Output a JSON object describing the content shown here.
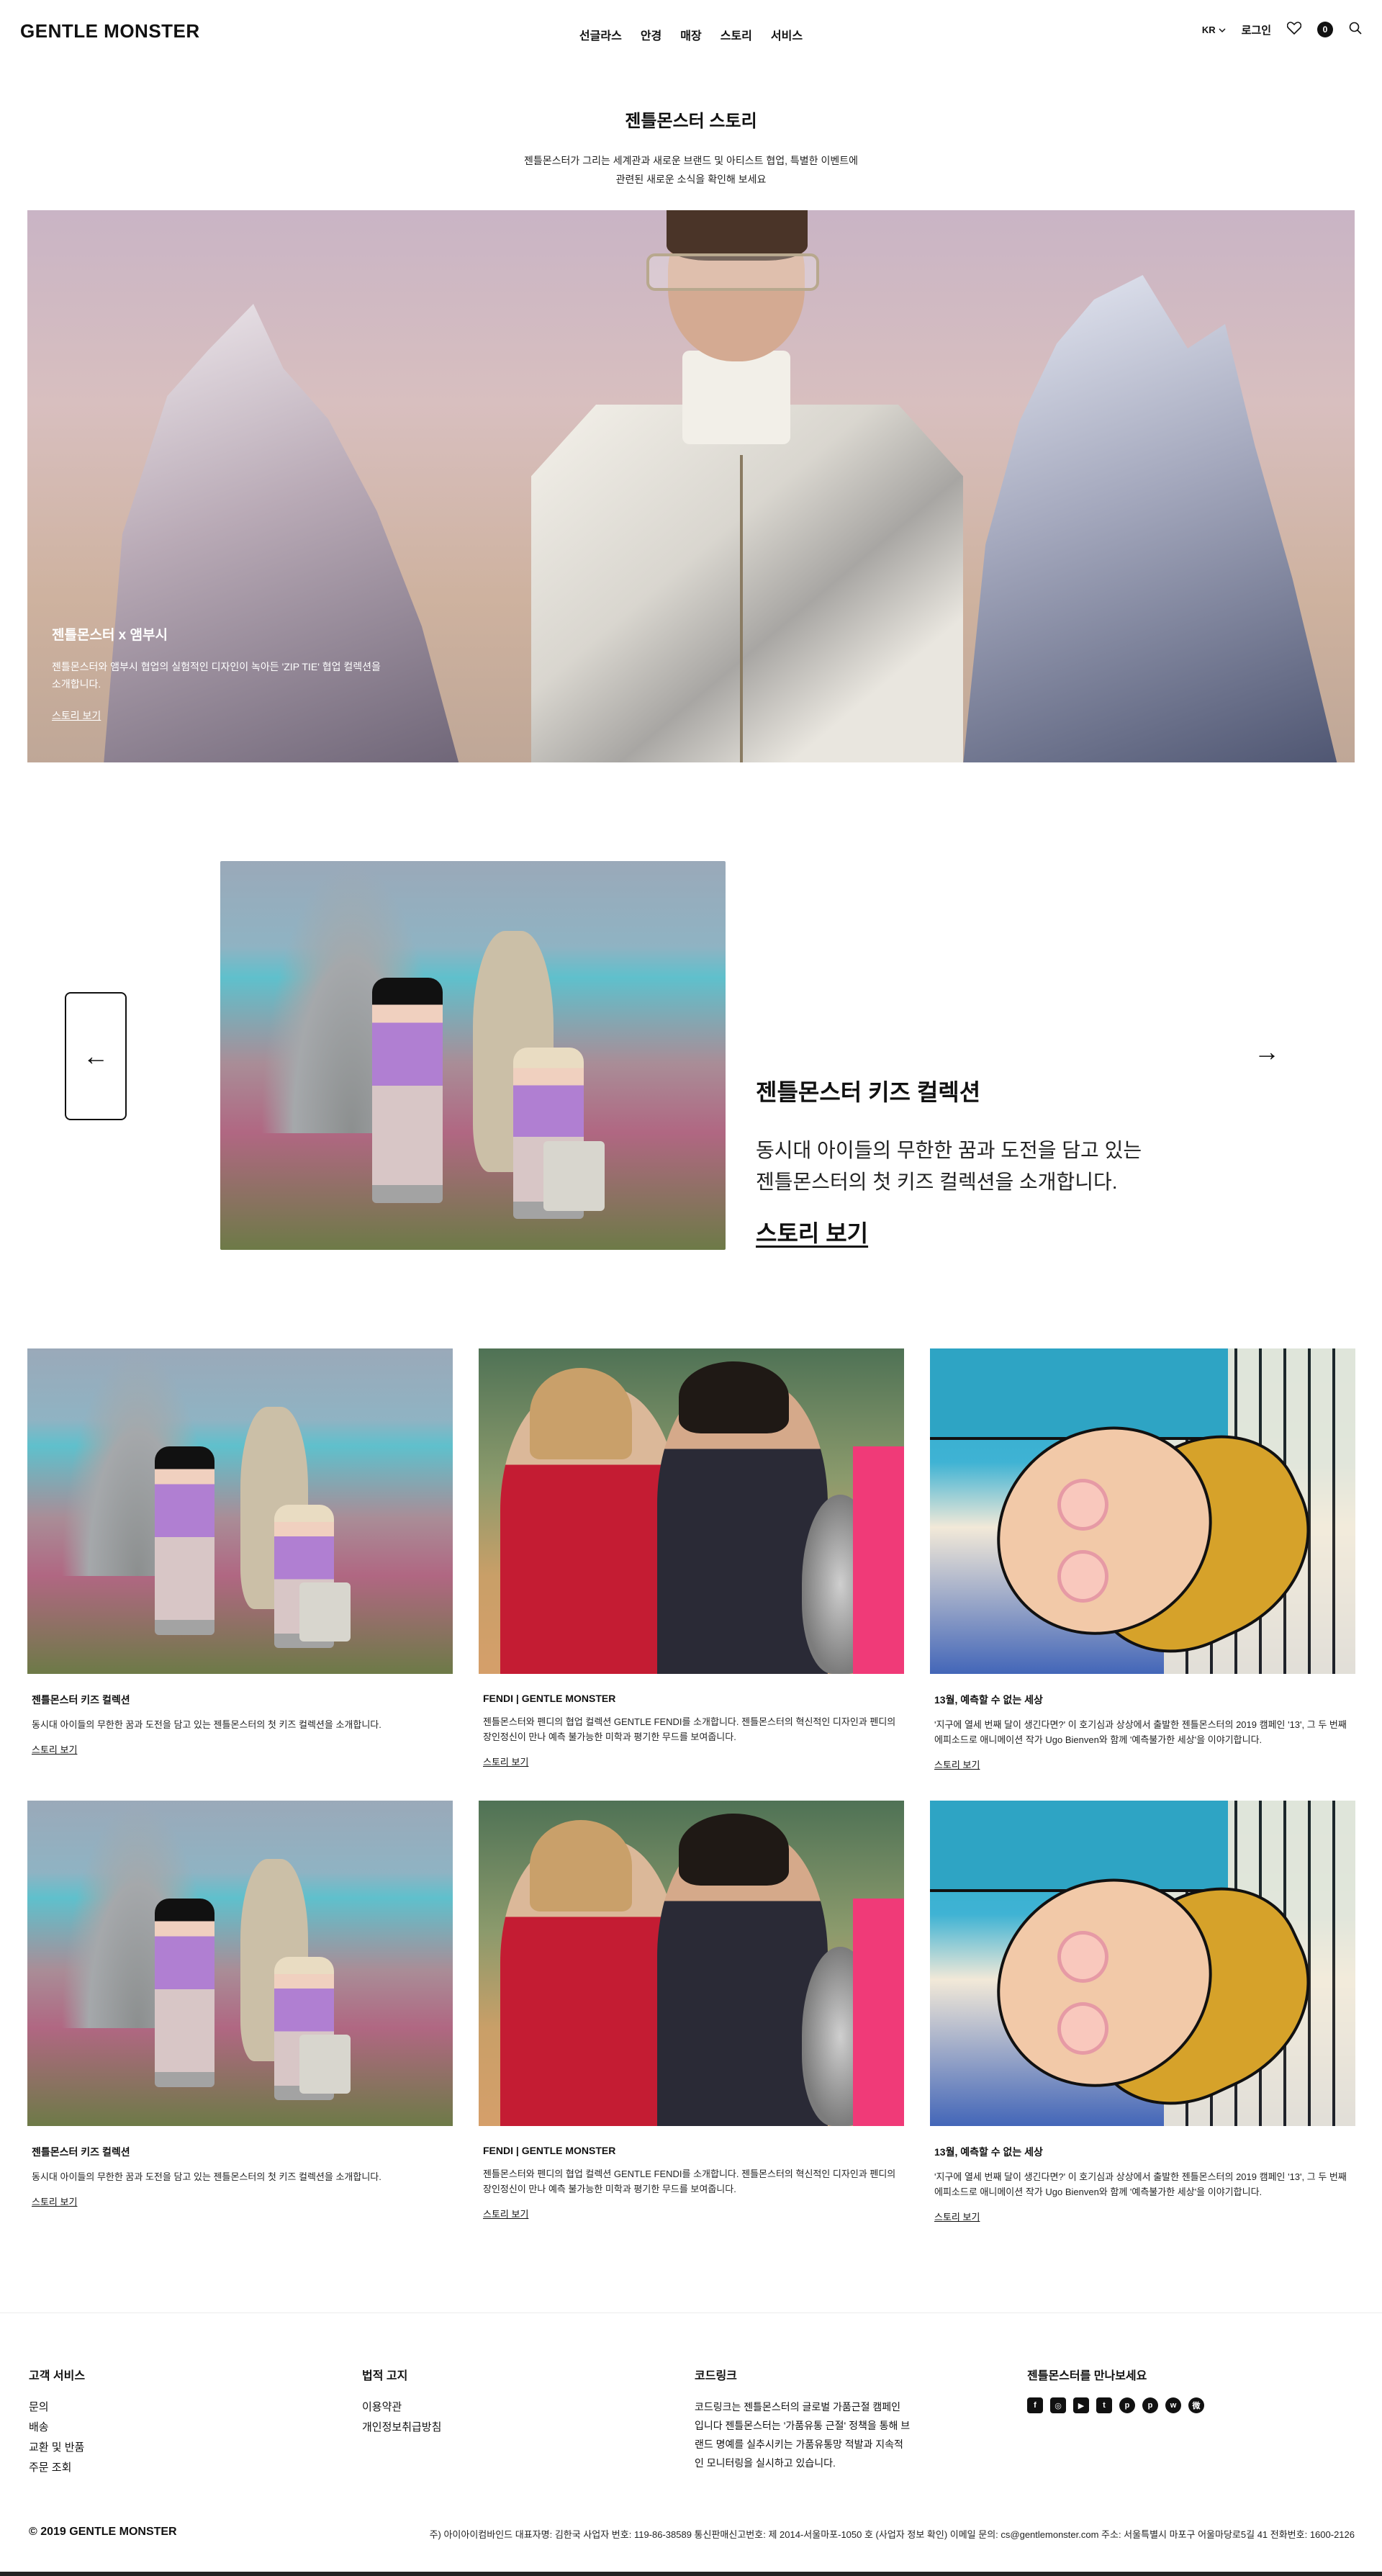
{
  "header": {
    "logo": "GENTLE MONSTER",
    "nav": [
      "선글라스",
      "안경",
      "매장",
      "스토리",
      "서비스"
    ],
    "lang": "KR",
    "login": "로그인",
    "cart_count": "0"
  },
  "intro": {
    "title": "젠틀몬스터 스토리",
    "desc_line1": "젠틀몬스터가 그리는 세계관과 새로운 브랜드 및 아티스트 협업, 특별한 이벤트에",
    "desc_line2": "관련된 새로운 소식을 확인해 보세요"
  },
  "hero": {
    "title": "젠틀몬스터 x 앰부시",
    "desc": "젠틀몬스터와 앰부시 협업의 실험적인 디자인이 녹아든 'ZIP TIE' 협업 컬렉션을 소개합니다.",
    "link": "스토리 보기"
  },
  "feature": {
    "prev": "←",
    "next": "→",
    "title": "젠틀몬스터 키즈 컬렉션",
    "desc_line1": "동시대 아이들의 무한한 꿈과 도전을 담고 있는",
    "desc_line2": "젠틀몬스터의 첫 키즈 컬렉션을 소개합니다.",
    "link": "스토리 보기"
  },
  "cards": [
    {
      "title": "젠틀몬스터 키즈 컬렉션",
      "desc": "동시대 아이들의 무한한 꿈과 도전을 담고 있는 젠틀몬스터의 첫 키즈 컬렉션을 소개합니다.",
      "link": "스토리 보기"
    },
    {
      "title": "FENDI | GENTLE MONSTER",
      "desc": "젠틀몬스터와 펜디의 협업 컬렉션 GENTLE FENDI를 소개합니다. 젠틀몬스터의 혁신적인 디자인과 펜디의 장인정신이 만나 예측 불가능한 미학과 평기한 무드를 보여줍니다.",
      "link": "스토리 보기"
    },
    {
      "title": "13월, 예측할 수 없는 세상",
      "desc": "'지구에 열세 번째 달이 생긴다면?' 이 호기심과 상상에서 출발한 젠틀몬스터의 2019 캠페인 '13', 그 두 번째 에피소드로 애니메이션 작가 Ugo Bienven와 함께 '예측불가한 세상'을 이야기합니다.",
      "link": "스토리 보기"
    },
    {
      "title": "젠틀몬스터 키즈 컬렉션",
      "desc": "동시대 아이들의 무한한 꿈과 도전을 담고 있는 젠틀몬스터의 첫 키즈 컬렉션을 소개합니다.",
      "link": "스토리 보기"
    },
    {
      "title": "FENDI | GENTLE MONSTER",
      "desc": "젠틀몬스터와 펜디의 협업 컬렉션 GENTLE FENDI를 소개합니다. 젠틀몬스터의 혁신적인 디자인과 펜디의 장인정신이 만나 예측 불가능한 미학과 평기한 무드를 보여줍니다.",
      "link": "스토리 보기"
    },
    {
      "title": "13월, 예측할 수 없는 세상",
      "desc": "'지구에 열세 번째 달이 생긴다면?' 이 호기심과 상상에서 출발한 젠틀몬스터의 2019 캠페인 '13', 그 두 번째 에피소드로 애니메이션 작가 Ugo Bienven와 함께 '예측불가한 세상'을 이야기합니다.",
      "link": "스토리 보기"
    }
  ],
  "footer": {
    "customer": {
      "title": "고객 서비스",
      "items": [
        "문의",
        "배송",
        "교환 및 반품",
        "주문 조회"
      ]
    },
    "legal": {
      "title": "법적 고지",
      "items": [
        "이용약관",
        "개인정보취급방침"
      ]
    },
    "coding": {
      "title": "코드링크",
      "text": "코드링크는 젠틀몬스터의 글로벌 가품근절 캠페인 입니다 젠틀몬스터는 '가품유통 근절' 정책을 통해 브랜드 명예를 실추시키는 가품유통망 적발과 지속적인 모니터링을 실시하고 있습니다."
    },
    "social": {
      "title": "젠틀몬스터를 만나보세요",
      "icons": [
        "facebook-icon",
        "instagram-icon",
        "youtube-icon",
        "twitter-icon",
        "pinterest-icon",
        "pinterest-alt-icon",
        "wechat-icon",
        "weibo-icon"
      ]
    },
    "copyright": "© 2019 GENTLE MONSTER",
    "company": "주) 아이아이컴바인드 대표자명: 김한국 사업자 번호: 119-86-38589 통신판매신고번호: 제 2014-서울마포-1050 호 (사업자 정보 확인) 이메일 문의: cs@gentlemonster.com 주소: 서울특별시 마포구 어울마당로5길 41 전화번호: 1600-2126"
  }
}
